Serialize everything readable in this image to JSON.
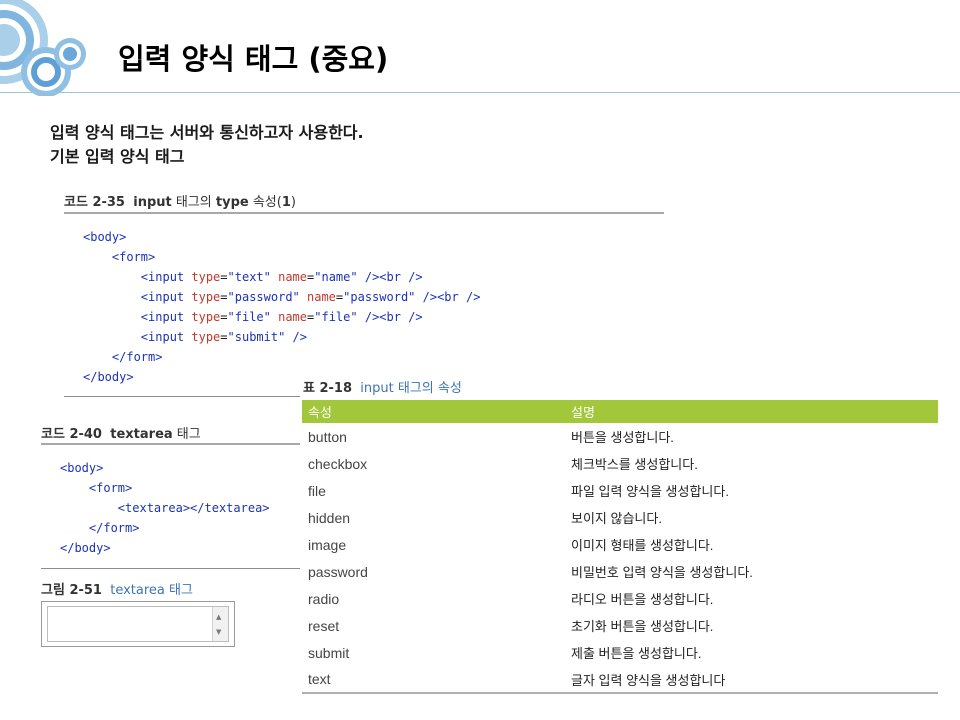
{
  "title": "입력 양식 태그 (중요)",
  "intro": [
    "입력 양식 태그는 서버와 통신하고자 사용한다.",
    "기본 입력 양식 태그"
  ],
  "code1": {
    "caption_num": "코드 2-35",
    "caption_kw": "input",
    "caption_mid": " 태그의 ",
    "caption_kw2": "type",
    "caption_rest": " 속성(",
    "caption_one": "1",
    "caption_close": ")",
    "lines": [
      {
        "indent": "",
        "parts": [
          [
            "tag",
            "<body>"
          ]
        ]
      },
      {
        "indent": "    ",
        "parts": [
          [
            "tag",
            "<form>"
          ]
        ]
      },
      {
        "indent": "        ",
        "parts": [
          [
            "tag",
            "<input "
          ],
          [
            "attr",
            "type"
          ],
          [
            "plain",
            "="
          ],
          [
            "str",
            "\"text\""
          ],
          [
            "plain",
            " "
          ],
          [
            "attr",
            "name"
          ],
          [
            "plain",
            "="
          ],
          [
            "str",
            "\"name\""
          ],
          [
            "plain",
            " "
          ],
          [
            "tag",
            "/><br />"
          ]
        ]
      },
      {
        "indent": "        ",
        "parts": [
          [
            "tag",
            "<input "
          ],
          [
            "attr",
            "type"
          ],
          [
            "plain",
            "="
          ],
          [
            "str",
            "\"password\""
          ],
          [
            "plain",
            " "
          ],
          [
            "attr",
            "name"
          ],
          [
            "plain",
            "="
          ],
          [
            "str",
            "\"password\""
          ],
          [
            "plain",
            " "
          ],
          [
            "tag",
            "/><br />"
          ]
        ]
      },
      {
        "indent": "        ",
        "parts": [
          [
            "tag",
            "<input "
          ],
          [
            "attr",
            "type"
          ],
          [
            "plain",
            "="
          ],
          [
            "str",
            "\"file\""
          ],
          [
            "plain",
            " "
          ],
          [
            "attr",
            "name"
          ],
          [
            "plain",
            "="
          ],
          [
            "str",
            "\"file\""
          ],
          [
            "plain",
            " "
          ],
          [
            "tag",
            "/><br />"
          ]
        ]
      },
      {
        "indent": "        ",
        "parts": [
          [
            "tag",
            "<input "
          ],
          [
            "attr",
            "type"
          ],
          [
            "plain",
            "="
          ],
          [
            "str",
            "\"submit\""
          ],
          [
            "plain",
            " "
          ],
          [
            "tag",
            "/>"
          ]
        ]
      },
      {
        "indent": "    ",
        "parts": [
          [
            "tag",
            "</form>"
          ]
        ]
      },
      {
        "indent": "",
        "parts": [
          [
            "tag",
            "</body>"
          ]
        ]
      }
    ]
  },
  "code2": {
    "caption_num": "코드 2-40",
    "caption_kw": "textarea",
    "caption_rest": " 태그",
    "lines": [
      {
        "indent": "",
        "parts": [
          [
            "tag",
            "<body>"
          ]
        ]
      },
      {
        "indent": "    ",
        "parts": [
          [
            "tag",
            "<form>"
          ]
        ]
      },
      {
        "indent": "        ",
        "parts": [
          [
            "tag",
            "<textarea></textarea>"
          ]
        ]
      },
      {
        "indent": "    ",
        "parts": [
          [
            "tag",
            "</form>"
          ]
        ]
      },
      {
        "indent": "",
        "parts": [
          [
            "tag",
            "</body>"
          ]
        ]
      }
    ]
  },
  "figure": {
    "caption_num": "그림 2-51",
    "caption_blue": "textarea 태그"
  },
  "table": {
    "caption_num": "표 2-18",
    "caption_blue": "input 태그의 속성",
    "headers": [
      "속성",
      "설명"
    ],
    "rows": [
      [
        "button",
        "버튼을 생성합니다."
      ],
      [
        "checkbox",
        "체크박스를 생성합니다."
      ],
      [
        "file",
        "파일 입력 양식을 생성합니다."
      ],
      [
        "hidden",
        "보이지 않습니다."
      ],
      [
        "image",
        "이미지 형태를 생성합니다."
      ],
      [
        "password",
        "비밀번호 입력 양식을 생성합니다."
      ],
      [
        "radio",
        "라디오 버튼을 생성합니다."
      ],
      [
        "reset",
        "초기화 버튼을 생성합니다."
      ],
      [
        "submit",
        "제출 버튼을 생성합니다."
      ],
      [
        "text",
        "글자 입력 양식을 생성합니다"
      ]
    ],
    "header_color": "#a2c73b"
  },
  "colors": {
    "tag": "#1a33b8",
    "attr": "#c0392b",
    "accent": "#3d74b6"
  },
  "icons": {
    "logo": "concentric-circles-logo",
    "scroll_up": "scroll-up-arrow-icon",
    "scroll_down": "scroll-down-arrow-icon"
  }
}
